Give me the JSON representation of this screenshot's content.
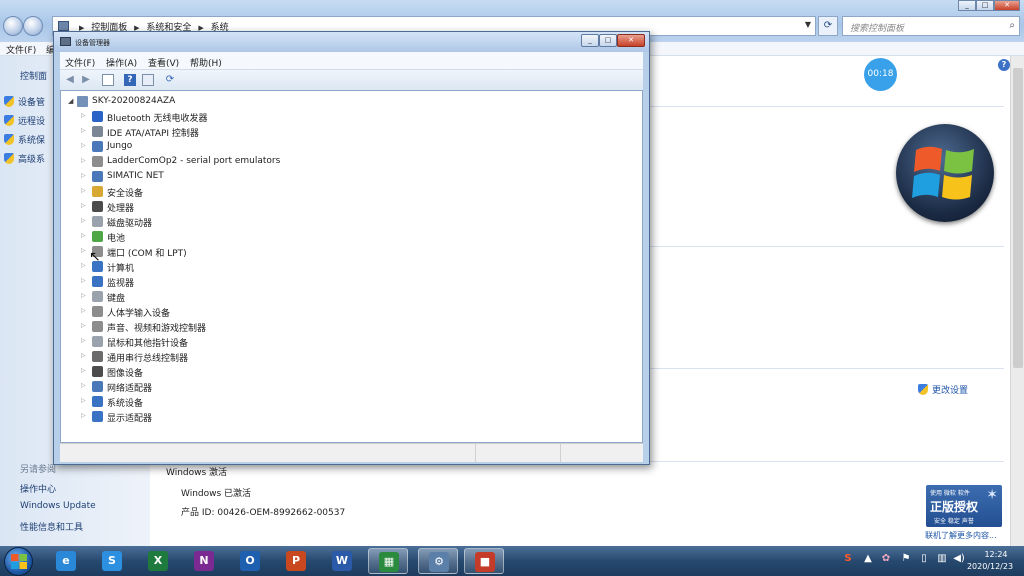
{
  "system_window": {
    "breadcrumbs": [
      "控制面板",
      "系统和安全",
      "系统"
    ],
    "search_placeholder": "搜索控制面板",
    "menu": {
      "file": "文件(F)",
      "edit_partial": "编"
    },
    "left_panel": {
      "home_partial": "控制面",
      "tasks": [
        "设备管",
        "远程设",
        "系统保",
        "高级系"
      ],
      "see_also_title": "另请参阅",
      "see_also": [
        "操作中心",
        "Windows Update",
        "性能信息和工具"
      ]
    },
    "timer": "00:18",
    "change_settings": "更改设置",
    "activation": {
      "section": "Windows 激活",
      "status": "Windows 已激活",
      "product_id": "产品 ID: 00426-OEM-8992662-00537"
    },
    "genuine_badge": {
      "line1": "使用 微软 软件",
      "line2": "正版授权",
      "line3": "安全 稳定 声誉"
    },
    "learn_more": "联机了解更多内容..."
  },
  "device_manager": {
    "title": "设备管理器",
    "menu": [
      "文件(F)",
      "操作(A)",
      "查看(V)",
      "帮助(H)"
    ],
    "root": "SKY-20200824AZA",
    "devices": [
      {
        "label": "Bluetooth 无线电收发器",
        "icon": "bluetooth-icon",
        "color": "#2a63c6"
      },
      {
        "label": "IDE ATA/ATAPI 控制器",
        "icon": "ide-controller-icon",
        "color": "#7c8796"
      },
      {
        "label": "Jungo",
        "icon": "jungo-icon",
        "color": "#4a78b8"
      },
      {
        "label": "LadderComOp2 - serial port emulators",
        "icon": "port-icon",
        "color": "#8d8d8d"
      },
      {
        "label": "SIMATIC NET",
        "icon": "network-icon",
        "color": "#4a78b8"
      },
      {
        "label": "安全设备",
        "icon": "security-key-icon",
        "color": "#d8a834"
      },
      {
        "label": "处理器",
        "icon": "processor-icon",
        "color": "#4c4c4c"
      },
      {
        "label": "磁盘驱动器",
        "icon": "disk-drive-icon",
        "color": "#9aa3ad"
      },
      {
        "label": "电池",
        "icon": "battery-icon",
        "color": "#4ea645"
      },
      {
        "label": "端口 (COM 和 LPT)",
        "icon": "port-icon",
        "color": "#8d8d8d"
      },
      {
        "label": "计算机",
        "icon": "computer-icon",
        "color": "#3a72c4"
      },
      {
        "label": "监视器",
        "icon": "monitor-icon",
        "color": "#3a72c4"
      },
      {
        "label": "键盘",
        "icon": "keyboard-icon",
        "color": "#9aa3ad"
      },
      {
        "label": "人体学输入设备",
        "icon": "hid-icon",
        "color": "#8d8d8d"
      },
      {
        "label": "声音、视频和游戏控制器",
        "icon": "speaker-icon",
        "color": "#8d8d8d"
      },
      {
        "label": "鼠标和其他指针设备",
        "icon": "mouse-icon",
        "color": "#9aa3ad"
      },
      {
        "label": "通用串行总线控制器",
        "icon": "usb-icon",
        "color": "#6b6b6b"
      },
      {
        "label": "图像设备",
        "icon": "camera-icon",
        "color": "#4c4c4c"
      },
      {
        "label": "网络适配器",
        "icon": "network-icon",
        "color": "#4a78b8"
      },
      {
        "label": "系统设备",
        "icon": "system-device-icon",
        "color": "#3a72c4"
      },
      {
        "label": "显示适配器",
        "icon": "display-adapter-icon",
        "color": "#3a72c4"
      }
    ]
  },
  "taskbar": {
    "apps": [
      {
        "name": "ie-app",
        "glyph": "e",
        "color": "#2a88d8"
      },
      {
        "name": "sogou-app",
        "glyph": "S",
        "color": "#2d8fe0"
      },
      {
        "name": "excel-app",
        "glyph": "X",
        "color": "#1f7a3e"
      },
      {
        "name": "onenote-app",
        "glyph": "N",
        "color": "#7b2a91"
      },
      {
        "name": "outlook-app",
        "glyph": "O",
        "color": "#1f5fb0"
      },
      {
        "name": "powerpoint-app",
        "glyph": "P",
        "color": "#c9481f"
      },
      {
        "name": "word-app",
        "glyph": "W",
        "color": "#2a5aa8"
      },
      {
        "name": "spreadsheet-app",
        "glyph": "▦",
        "color": "#2a8a3e"
      },
      {
        "name": "device-manager-app",
        "glyph": "⚙",
        "color": "#5b7fa8"
      },
      {
        "name": "toolbox-app",
        "glyph": "■",
        "color": "#c43b2a"
      }
    ],
    "clock_time": "12:24",
    "clock_date": "2020/12/23"
  }
}
